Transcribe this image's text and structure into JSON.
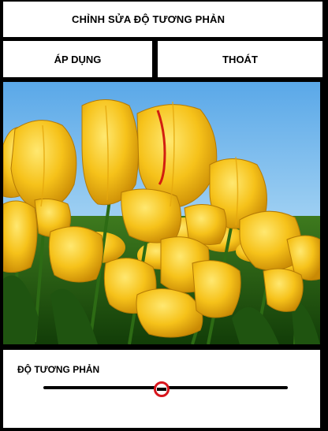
{
  "header": {
    "title": "CHỈNH SỬA ĐỘ TƯƠNG PHẢN"
  },
  "actions": {
    "apply_label": "ÁP DỤNG",
    "exit_label": "THOÁT"
  },
  "photo": {
    "subject": "yellow-tulips-photo"
  },
  "contrast": {
    "label": "ĐỘ TƯƠNG PHẢN",
    "level": 0.48
  },
  "colors": {
    "slider_thumb_ring": "#d8151c",
    "slider_track": "#000000",
    "background": "#000000"
  }
}
